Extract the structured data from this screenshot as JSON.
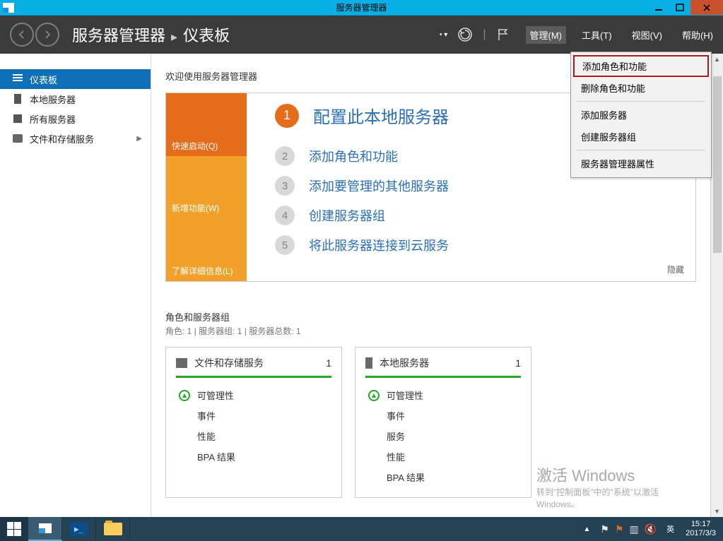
{
  "titlebar": {
    "title": "服务器管理器"
  },
  "breadcrumb": {
    "root": "服务器管理器",
    "sub": "仪表板"
  },
  "menubar": {
    "manage": "管理(M)",
    "tools": "工具(T)",
    "view": "视图(V)",
    "help": "帮助(H)"
  },
  "dropdown": {
    "add_roles": "添加角色和功能",
    "remove_roles": "删除角色和功能",
    "add_server": "添加服务器",
    "create_group": "创建服务器组",
    "properties": "服务器管理器属性"
  },
  "sidebar": {
    "dashboard": "仪表板",
    "local_server": "本地服务器",
    "all_servers": "所有服务器",
    "file_storage": "文件和存储服务"
  },
  "welcome": {
    "title": "欢迎使用服务器管理器",
    "tabs": {
      "quickstart": "快速启动(Q)",
      "whatsnew": "新增功能(W)",
      "learnmore": "了解详细信息(L)"
    },
    "steps": {
      "s1": "配置此本地服务器",
      "s2": "添加角色和功能",
      "s3": "添加要管理的其他服务器",
      "s4": "创建服务器组",
      "s5": "将此服务器连接到云服务"
    },
    "hide": "隐藏",
    "nums": {
      "n1": "1",
      "n2": "2",
      "n3": "3",
      "n4": "4",
      "n5": "5"
    }
  },
  "section": {
    "title": "角色和服务器组",
    "sub": "角色: 1 | 服务器组: 1 | 服务器总数: 1"
  },
  "tiles": {
    "file": {
      "name": "文件和存储服务",
      "count": "1",
      "rows": {
        "manageability": "可管理性",
        "events": "事件",
        "performance": "性能",
        "bpa": "BPA 结果"
      }
    },
    "local": {
      "name": "本地服务器",
      "count": "1",
      "rows": {
        "manageability": "可管理性",
        "events": "事件",
        "services": "服务",
        "performance": "性能",
        "bpa": "BPA 结果"
      }
    }
  },
  "watermark": {
    "big": "激活 Windows",
    "small": "转到\"控制面板\"中的\"系统\"以激活 Windows。"
  },
  "taskbar": {
    "ime": "英",
    "time": "15:17",
    "date": "2017/3/3"
  }
}
